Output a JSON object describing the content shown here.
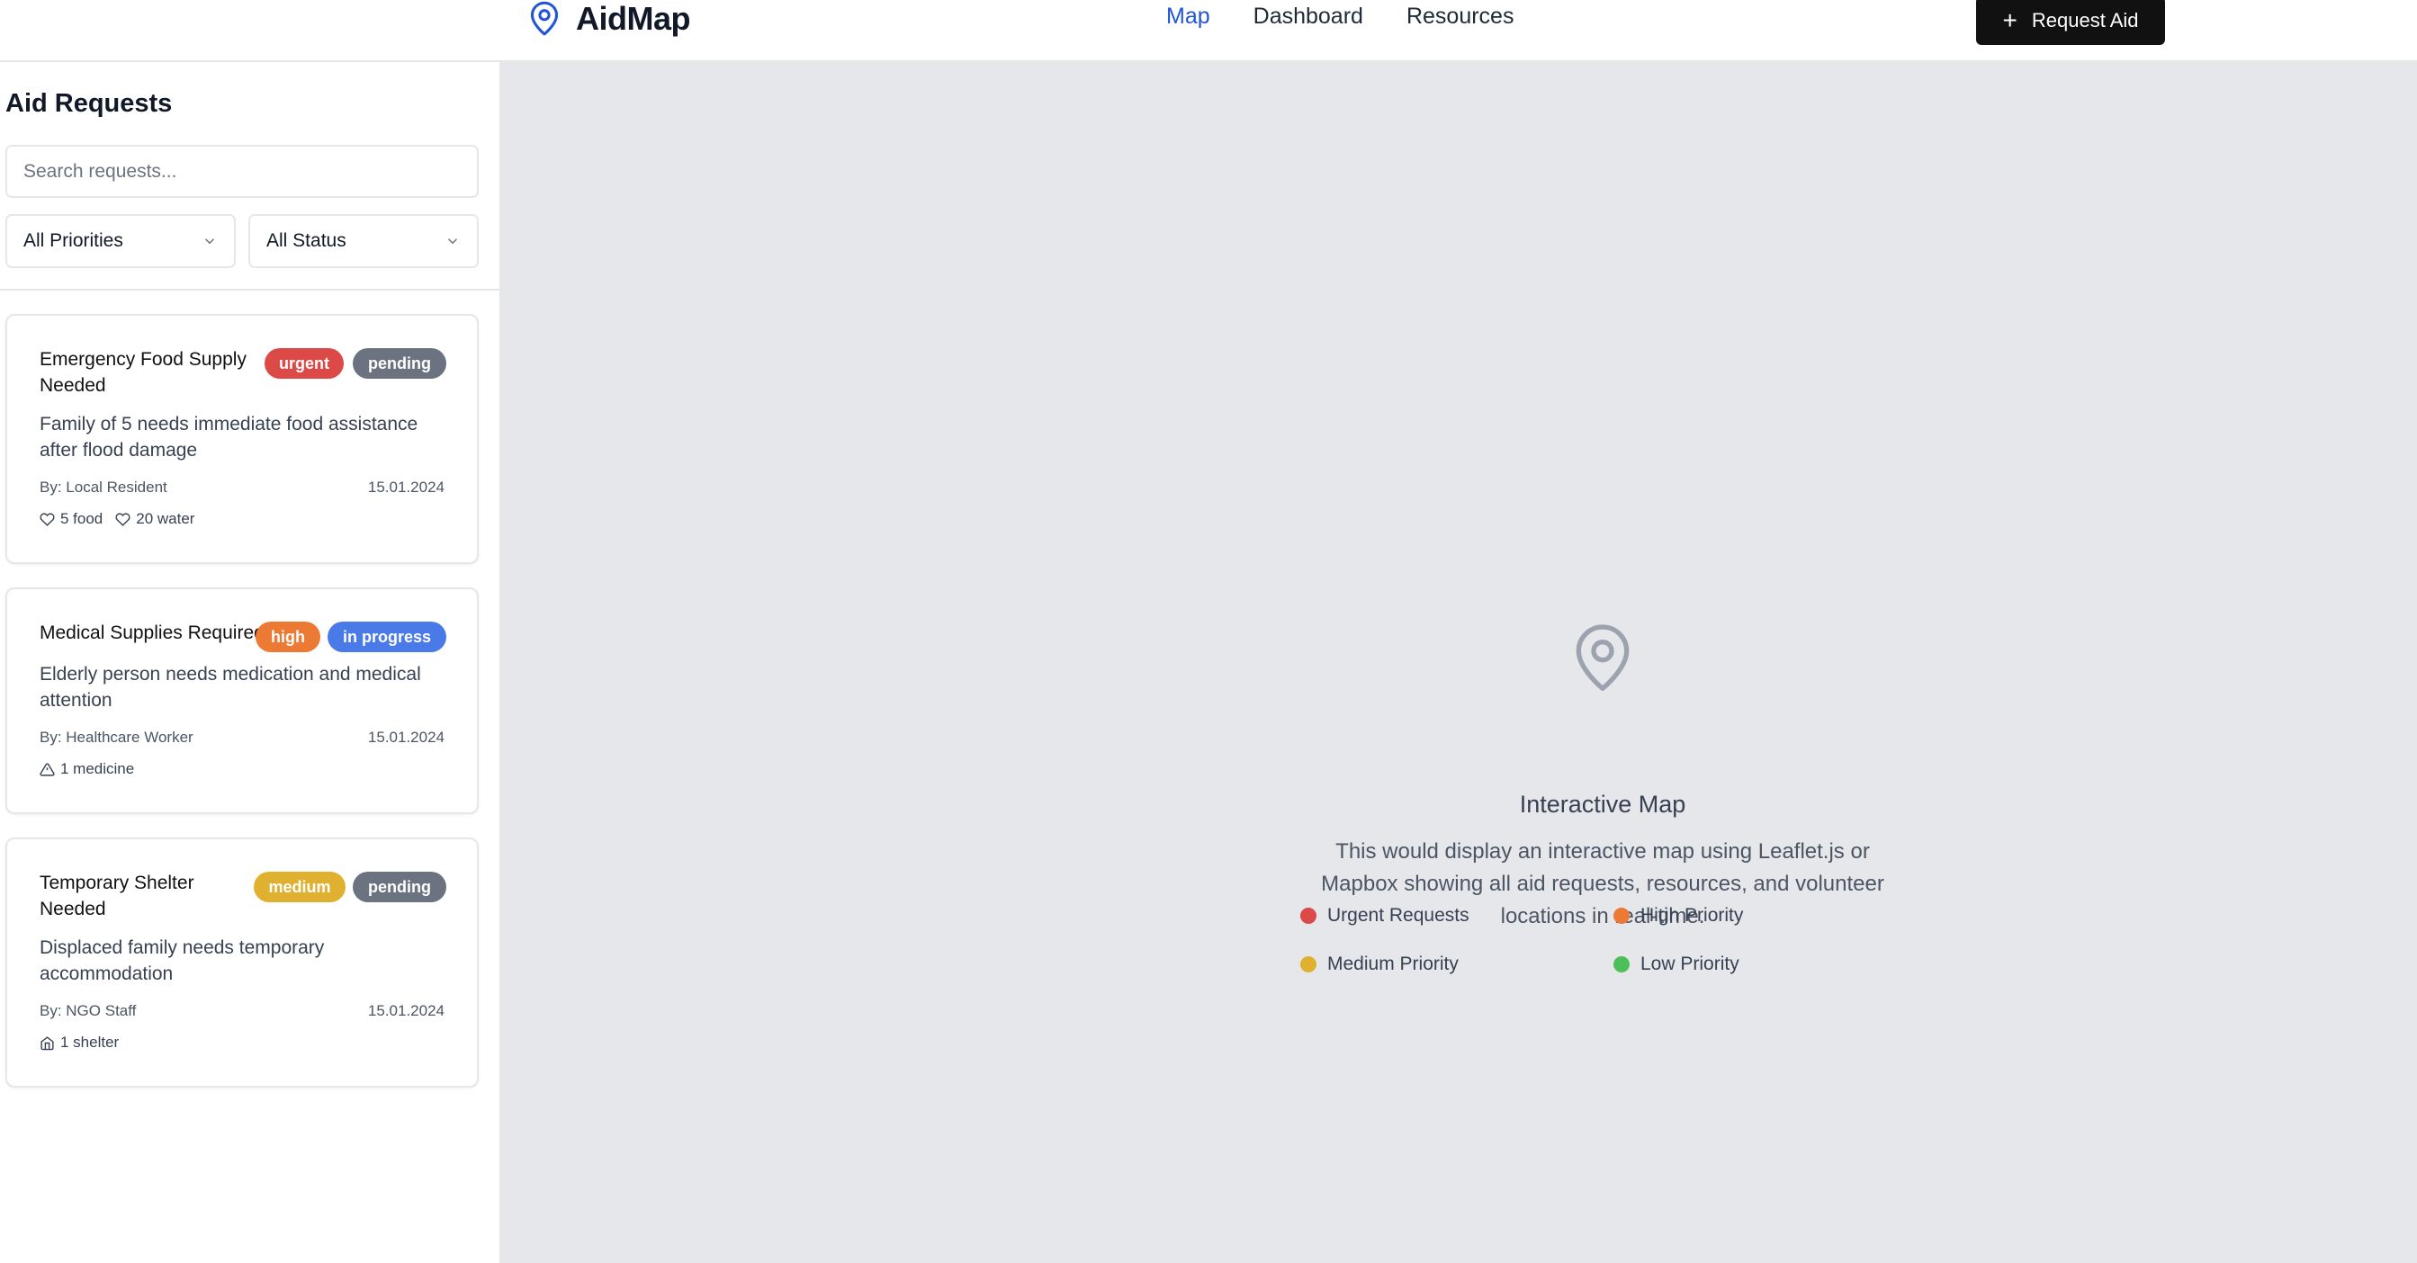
{
  "header": {
    "brand": "AidMap",
    "nav": [
      {
        "label": "Map",
        "active": true
      },
      {
        "label": "Dashboard",
        "active": false
      },
      {
        "label": "Resources",
        "active": false
      }
    ],
    "request_button": "Request Aid"
  },
  "sidebar": {
    "title": "Aid Requests",
    "search_placeholder": "Search requests...",
    "priority_filter": "All Priorities",
    "status_filter": "All Status"
  },
  "requests": [
    {
      "title_line1": "Emergency Food Supply",
      "title_line2": "Needed",
      "priority": "urgent",
      "status": "pending",
      "desc_line1": "Family of 5 needs immediate food assistance",
      "desc_line2": "after flood damage",
      "by": "By: Local Resident",
      "date": "15.01.2024",
      "items": [
        {
          "icon": "heart-icon",
          "text": "5 food"
        },
        {
          "icon": "heart-icon",
          "text": "20 water"
        }
      ]
    },
    {
      "title_line1": "Medical Supplies Required",
      "title_line2": "",
      "priority": "high",
      "status": "in progress",
      "desc_line1": "Elderly person needs medication and medical",
      "desc_line2": "attention",
      "by": "By: Healthcare Worker",
      "date": "15.01.2024",
      "items": [
        {
          "icon": "alert-triangle-icon",
          "text": "1 medicine"
        }
      ]
    },
    {
      "title_line1": "Temporary Shelter",
      "title_line2": "Needed",
      "priority": "medium",
      "status": "pending",
      "desc_line1": "Displaced family needs temporary",
      "desc_line2": "accommodation",
      "by": "By: NGO Staff",
      "date": "15.01.2024",
      "items": [
        {
          "icon": "home-icon",
          "text": "1 shelter"
        }
      ]
    }
  ],
  "map": {
    "title": "Interactive Map",
    "desc_line1": "This would display an interactive map using Leaflet.js or",
    "desc_line2": "Mapbox showing all aid requests, resources, and volunteer",
    "desc_line3": "locations in real-time.",
    "legend": [
      {
        "label": "Urgent Requests",
        "color": "#dc4a47"
      },
      {
        "label": "High Priority",
        "color": "#ec7a35"
      },
      {
        "label": "Medium Priority",
        "color": "#e0b030"
      },
      {
        "label": "Low Priority",
        "color": "#4cbf5a"
      }
    ]
  },
  "colors": {
    "accent": "#2255d6",
    "urgent": "#dc4a47",
    "high": "#ec7a35",
    "medium": "#e0b030",
    "pending": "#6b7280",
    "in_progress": "#4a7ae8"
  }
}
